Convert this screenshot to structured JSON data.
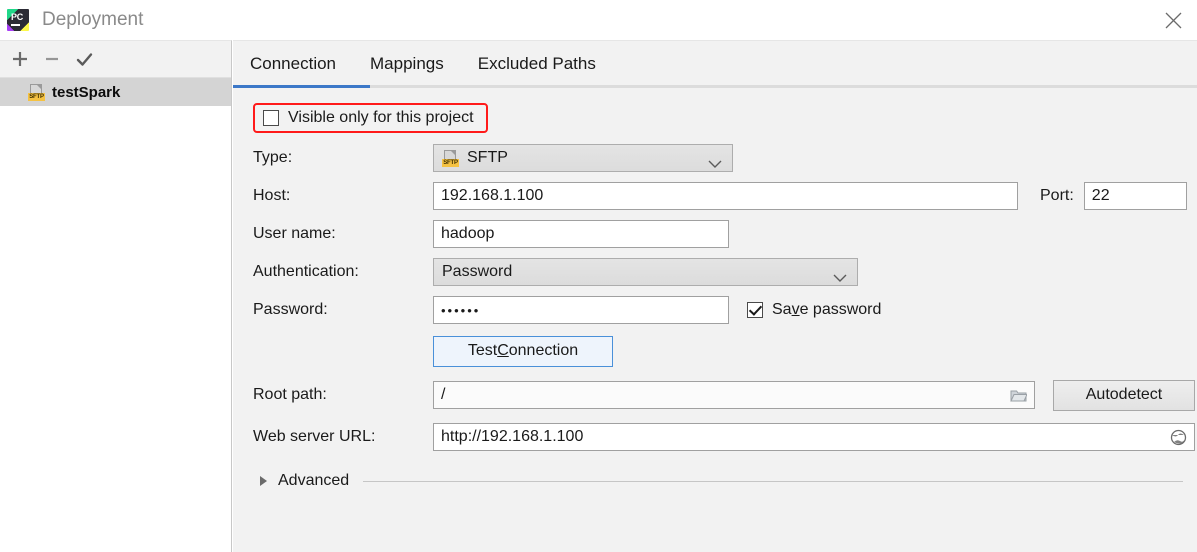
{
  "window": {
    "title": "Deployment",
    "app_icon": "pycharm-icon",
    "close_icon": "close-icon"
  },
  "sidebar": {
    "toolbar": [
      {
        "name": "add-server-button",
        "icon": "plus-icon"
      },
      {
        "name": "remove-server-button",
        "icon": "minus-icon"
      },
      {
        "name": "set-default-server-button",
        "icon": "check-icon"
      }
    ],
    "items": [
      {
        "label": "testSpark",
        "icon": "sftp-icon",
        "badge": "SFTP",
        "selected": true
      }
    ]
  },
  "tabs": [
    {
      "label": "Connection",
      "active": true
    },
    {
      "label": "Mappings",
      "active": false
    },
    {
      "label": "Excluded Paths",
      "active": false
    }
  ],
  "form": {
    "visible_only": {
      "label": "Visible only for this project",
      "checked": false,
      "highlight_color": "#ff1a1a"
    },
    "type": {
      "label": "Type:",
      "value": "SFTP",
      "icon": "sftp-icon",
      "badge": "SFTP"
    },
    "host": {
      "label": "Host:",
      "value": "192.168.1.100"
    },
    "port": {
      "label": "Port:",
      "value": "22"
    },
    "username": {
      "label": "User name:",
      "value": "hadoop"
    },
    "authentication": {
      "label": "Authentication:",
      "value": "Password"
    },
    "password": {
      "label": "Password:",
      "value": "••••••"
    },
    "save_password": {
      "label_before": "Sa",
      "label_mnemonic": "v",
      "label_after": "e password",
      "checked": true
    },
    "test_connection": {
      "label_before": "Test ",
      "label_mnemonic": "C",
      "label_after": "onnection"
    },
    "root_path": {
      "label": "Root path:",
      "value": "/",
      "icon": "folder-icon"
    },
    "autodetect": {
      "label": "Autodetect"
    },
    "web_server_url": {
      "label": "Web server URL:",
      "value": "http://192.168.1.100",
      "icon": "globe-icon"
    },
    "advanced": {
      "label": "Advanced",
      "expanded": false,
      "icon": "triangle-right-icon"
    }
  },
  "colors": {
    "accent": "#3c78c8",
    "highlight": "#ff1a1a",
    "panel": "#f2f2f2",
    "selection": "#d4d4d4"
  }
}
